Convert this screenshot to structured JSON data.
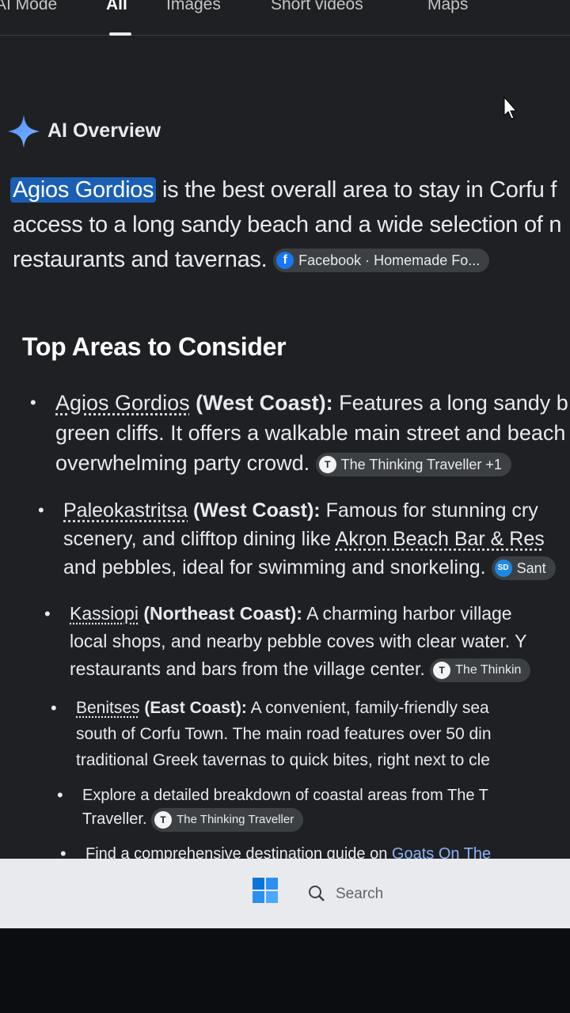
{
  "tabs": [
    "AI Mode",
    "All",
    "Images",
    "Short videos",
    "Maps"
  ],
  "ai_overview": {
    "title": "AI Overview",
    "highlight": "Agios Gordios",
    "lines": [
      " is the best overall area to stay in Corfu f",
      "access to a long sandy beach and a wide selection of n",
      "restaurants and tavernas. "
    ],
    "source_chip": "Facebook · Homemade Fo..."
  },
  "section_title": "Top Areas to Consider",
  "areas": [
    {
      "name": "Agios Gordios",
      "region": " (West Coast):",
      "lines": [
        " Features a long sandy b",
        "green cliffs. It offers a walkable main street and beach",
        "overwhelming party crowd. "
      ],
      "chip": "The Thinking Traveller +1",
      "chip_icon": "T"
    },
    {
      "name": "Paleokastritsa",
      "region": " (West Coast):",
      "lines": [
        " Famous for stunning cry",
        "scenery, and clifftop dining like ",
        "and pebbles, ideal for swimming and snorkeling. "
      ],
      "inline_link": "Akron Beach Bar & Res",
      "chip": "Sant",
      "chip_icon": "SD"
    },
    {
      "name": "Kassiopi",
      "region": " (Northeast Coast):",
      "lines": [
        " A charming harbor village",
        "local shops, and nearby pebble coves with clear water. Y",
        "restaurants and bars from the village center. "
      ],
      "chip": "The Thinkin",
      "chip_icon": "T"
    },
    {
      "name": "Benitses",
      "region": " (East Coast):",
      "lines": [
        " A convenient, family-friendly sea",
        "south of Corfu Town. The main road features over 50 din",
        "traditional Greek tavernas to quick bites, right next to cle"
      ]
    }
  ],
  "explore": {
    "lines": [
      "Explore a detailed breakdown of coastal areas from The T",
      "Traveller. "
    ],
    "chip": "The Thinking Traveller",
    "chip_icon": "T"
  },
  "find": {
    "text": "Find a comprehensive destination guide on ",
    "link": "Goats On The"
  },
  "taskbar": {
    "search_label": "Search"
  }
}
